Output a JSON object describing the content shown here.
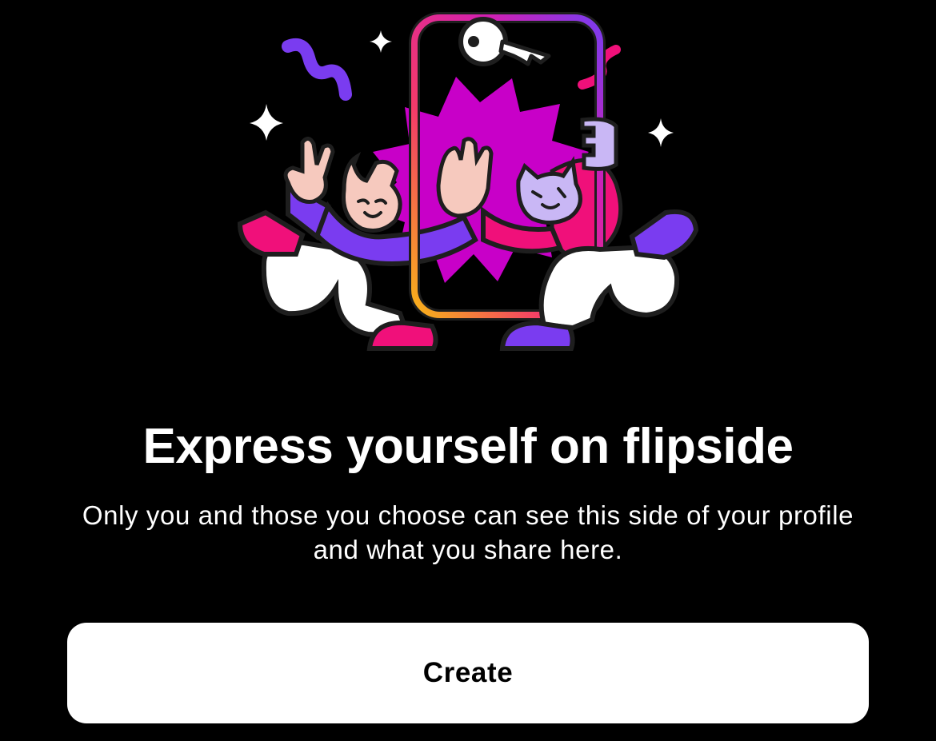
{
  "hero": {
    "illustration_name": "flipside-friends-phone-illustration",
    "colors": {
      "magenta": "#C800C8",
      "pink": "#F0107A",
      "purple": "#7A3CF0",
      "lavender": "#C9B7F5",
      "skin": "#F6C9BE",
      "gold": "#F8B318",
      "white": "#FFFFFF",
      "outline": "#1E1E1E"
    }
  },
  "title": "Express yourself on flipside",
  "subtitle": "Only you and those you choose can see this side of your profile and what you share here.",
  "create_button": {
    "label": "Create"
  },
  "theme": {
    "background": "#000000",
    "text": "#FFFFFF",
    "button_bg": "#FFFFFF",
    "button_text": "#000000"
  }
}
